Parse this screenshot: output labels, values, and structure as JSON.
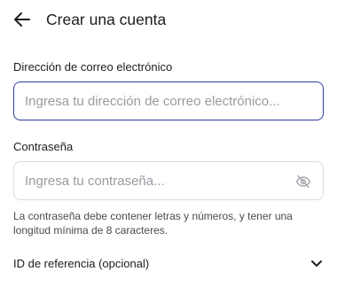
{
  "header": {
    "title": "Crear una cuenta",
    "back_icon": "arrow-left-icon"
  },
  "email": {
    "label": "Dirección de correo electrónico",
    "value": "",
    "placeholder": "Ingresa tu dirección de correo electrónico..."
  },
  "password": {
    "label": "Contraseña",
    "value": "",
    "placeholder": "Ingresa tu contraseña...",
    "visibility_icon": "eye-off-icon",
    "helper": "La contraseña debe contener letras y números, y tener una longitud mínima de 8 caracteres."
  },
  "referral": {
    "label": "ID de referencia (opcional)",
    "expand_icon": "chevron-down-icon"
  },
  "colors": {
    "focus_border": "#2e3c9c",
    "border": "#dcdcdf",
    "text": "#1c1c22",
    "placeholder": "#9a9aa2",
    "helper_text": "#4a4a52"
  }
}
